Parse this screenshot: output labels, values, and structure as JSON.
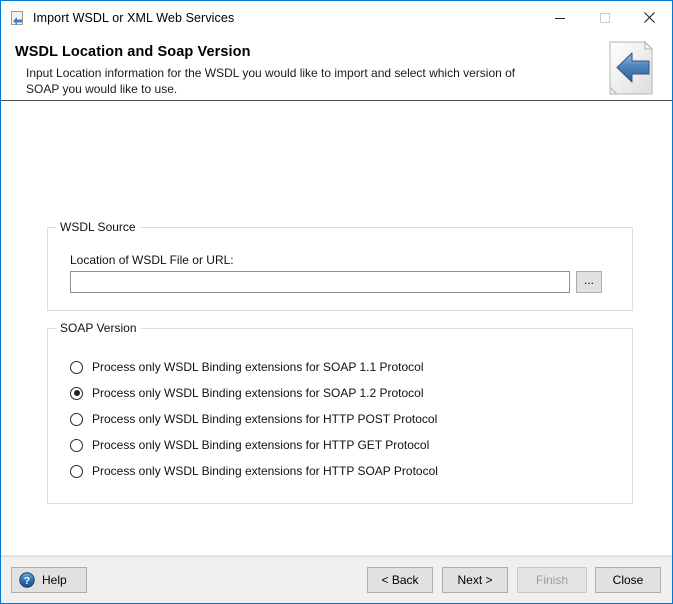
{
  "window": {
    "title": "Import WSDL or XML Web Services",
    "title_icon": "wsdl-import-icon",
    "border_color": "#0078d7",
    "controls": [
      {
        "name": "minimize",
        "glyph": "—",
        "enabled": true
      },
      {
        "name": "maximize",
        "glyph": "□",
        "enabled": false
      },
      {
        "name": "close",
        "glyph": "✕",
        "enabled": true
      }
    ]
  },
  "header": {
    "title": "WSDL Location and Soap Version",
    "subtitle": "Input Location information for the WSDL you would like to import and select which version of SOAP you would like to use.",
    "icon": "document-with-blue-left-arrow-icon",
    "accent_color": "#4a4a52"
  },
  "wsdl_source": {
    "group_label": "WSDL Source",
    "location_label": "Location of WSDL File or URL:",
    "location_value": "",
    "location_placeholder": "",
    "browse_label": "..."
  },
  "soap_version": {
    "group_label": "SOAP Version",
    "selected_index": 1,
    "options": [
      {
        "label": "Process only WSDL Binding extensions for SOAP 1.1 Protocol",
        "checked": false
      },
      {
        "label": "Process only WSDL Binding extensions for SOAP 1.2 Protocol",
        "checked": true
      },
      {
        "label": "Process only WSDL Binding extensions for HTTP POST Protocol",
        "checked": false
      },
      {
        "label": "Process only WSDL Binding extensions for HTTP GET Protocol",
        "checked": false
      },
      {
        "label": "Process only WSDL Binding extensions for HTTP SOAP Protocol",
        "checked": false
      }
    ]
  },
  "footer": {
    "help_label": "Help",
    "help_icon": "question-mark-circle-icon",
    "back_label": "< Back",
    "next_label": "Next >",
    "finish_label": "Finish",
    "finish_enabled": false,
    "close_label": "Close"
  }
}
